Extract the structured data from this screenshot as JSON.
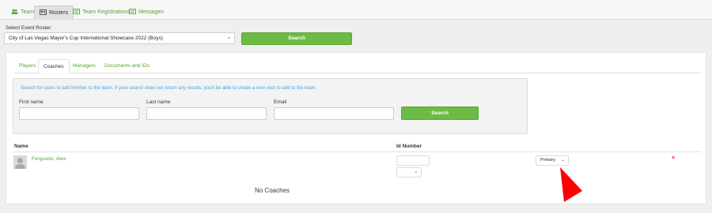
{
  "top_tabs": [
    {
      "label": "Team",
      "icon": "users-icon"
    },
    {
      "label": "Rosters",
      "icon": "roster-card-icon"
    },
    {
      "label": "Team Registrations",
      "icon": "list-icon"
    },
    {
      "label": "Messages",
      "icon": "message-list-icon"
    }
  ],
  "roster": {
    "label": "Select Event Roster",
    "selected": "City of Las Vegas Mayor's Cup International Showcase 2022 (Boys)",
    "search_label": "Search"
  },
  "sub_tabs": [
    "Players",
    "Coaches",
    "Managers",
    "Documents and IDs"
  ],
  "active_sub_tab": "Coaches",
  "coach_search": {
    "hint": "Search for users to add him/her to the team. If your search does not return any results, you'll be able to create a new user to add to the team.",
    "first_name_label": "First name",
    "last_name_label": "Last name",
    "email_label": "Email",
    "search_label": "Search"
  },
  "table": {
    "col_name": "Name",
    "col_id": "Id Number",
    "rows": [
      {
        "name": "Ferguson, Alex",
        "id_number": "",
        "role": "Primary",
        "remove": "×"
      }
    ],
    "empty_text": "No Coaches"
  },
  "colors": {
    "accent": "#6cbb45",
    "link": "#5aa33a",
    "hint": "#4aa3df",
    "danger": "#d9302c",
    "arrow": "#ff0000"
  }
}
